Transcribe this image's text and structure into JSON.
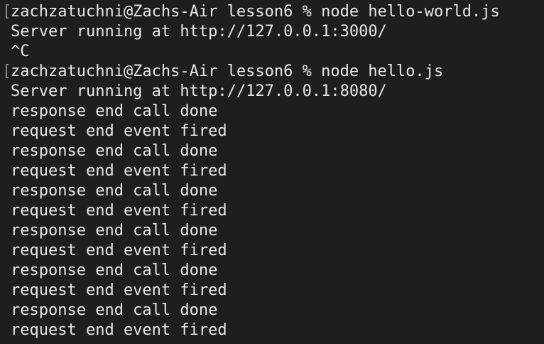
{
  "terminal": {
    "lines": [
      {
        "mark": "[",
        "text": "zachzatuchni@Zachs-Air lesson6 % node hello-world.js"
      },
      {
        "mark": "",
        "text": "Server running at http://127.0.0.1:3000/"
      },
      {
        "mark": "",
        "text": "^C"
      },
      {
        "mark": "[",
        "text": "zachzatuchni@Zachs-Air lesson6 % node hello.js"
      },
      {
        "mark": "",
        "text": "Server running at http://127.0.0.1:8080/"
      },
      {
        "mark": "",
        "text": "response end call done"
      },
      {
        "mark": "",
        "text": "request end event fired"
      },
      {
        "mark": "",
        "text": "response end call done"
      },
      {
        "mark": "",
        "text": "request end event fired"
      },
      {
        "mark": "",
        "text": "response end call done"
      },
      {
        "mark": "",
        "text": "request end event fired"
      },
      {
        "mark": "",
        "text": "response end call done"
      },
      {
        "mark": "",
        "text": "request end event fired"
      },
      {
        "mark": "",
        "text": "response end call done"
      },
      {
        "mark": "",
        "text": "request end event fired"
      },
      {
        "mark": "",
        "text": "response end call done"
      },
      {
        "mark": "",
        "text": "request end event fired"
      }
    ]
  }
}
